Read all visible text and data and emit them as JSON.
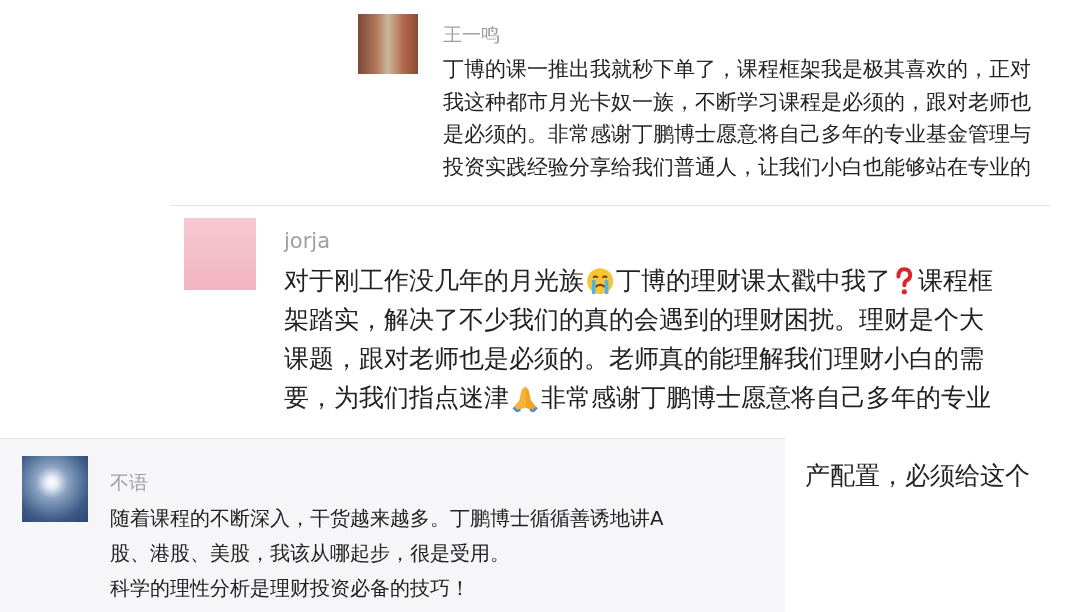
{
  "comments": [
    {
      "name": "王一鸣",
      "avatar": {
        "kind": "photo"
      },
      "lines": [
        {
          "parts": [
            {
              "kind": "text",
              "text": "丁博的课一推出我就秒下单了，课程框架我是极其喜欢的，正对"
            }
          ]
        },
        {
          "parts": [
            {
              "kind": "text",
              "text": "我这种都市月光卡奴一族，不断学习课程是必须的，跟对老师也"
            }
          ]
        },
        {
          "parts": [
            {
              "kind": "text",
              "text": "是必须的。非常感谢丁鹏博士愿意将自己多年的专业基金管理与"
            }
          ]
        },
        {
          "parts": [
            {
              "kind": "text",
              "text": "投资实践经验分享给我们普通人，让我们小白也能够站在专业的"
            }
          ]
        }
      ]
    },
    {
      "name": "jorja",
      "avatar": {
        "kind": "cartoon"
      },
      "lines": [
        {
          "parts": [
            {
              "kind": "text",
              "text": "对于刚工作没几年的月光族"
            },
            {
              "kind": "crying-face"
            },
            {
              "kind": "text",
              "text": "丁博的理财课太戳中我了"
            },
            {
              "kind": "question-mark"
            },
            {
              "kind": "text",
              "text": "课程框"
            }
          ]
        },
        {
          "parts": [
            {
              "kind": "text",
              "text": "架踏实，解决了不少我们的真的会遇到的理财困扰。理财是个大"
            }
          ]
        },
        {
          "parts": [
            {
              "kind": "text",
              "text": "课题，跟对老师也是必须的。老师真的能理解我们理财小白的需"
            }
          ]
        },
        {
          "parts": [
            {
              "kind": "text",
              "text": "要，为我们指点迷津"
            },
            {
              "kind": "praying-hands"
            },
            {
              "kind": "text",
              "text": "非常感谢丁鹏博士愿意将自己多年的专业"
            }
          ]
        },
        {
          "kind": "continuation",
          "parts": [
            {
              "kind": "text",
              "text": "产配置，必须给这个"
            }
          ]
        }
      ]
    },
    {
      "name": "不语",
      "avatar": {
        "kind": "sky"
      },
      "lines": [
        {
          "parts": [
            {
              "kind": "text",
              "text": "随着课程的不断深入，干货越来越多。丁鹏博士循循善诱地讲A"
            }
          ]
        },
        {
          "parts": [
            {
              "kind": "text",
              "text": "股、港股、美股，我该从哪起步，很是受用。"
            }
          ]
        },
        {
          "parts": [
            {
              "kind": "text",
              "text": "科学的理性分析是理财投资必备的技巧！"
            }
          ]
        }
      ]
    }
  ]
}
